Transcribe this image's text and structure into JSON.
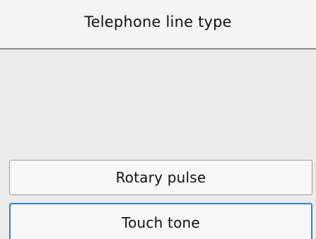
{
  "header": {
    "title": "Telephone line type"
  },
  "options": [
    {
      "label": "Rotary pulse",
      "selected": false
    },
    {
      "label": "Touch tone",
      "selected": true
    }
  ],
  "colors": {
    "background": "#ebebeb",
    "header_background": "#f4f4f4",
    "button_background": "#f7f7f7",
    "selected_border": "#2f86c8"
  }
}
